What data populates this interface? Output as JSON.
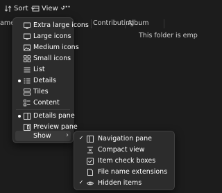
{
  "toolbar": {
    "sort_label": "Sort",
    "view_label": "View",
    "more_label": "···"
  },
  "columns": {
    "name": "ame",
    "contributing": "Contributing ...",
    "album": "Album"
  },
  "empty_message": "This folder is emp",
  "view_menu": {
    "items": [
      {
        "label": "Extra large icons",
        "icon": "monitor-icon",
        "checked": false,
        "selected": false
      },
      {
        "label": "Large icons",
        "icon": "monitor-icon",
        "checked": false,
        "selected": false
      },
      {
        "label": "Medium icons",
        "icon": "image-icon",
        "checked": false,
        "selected": false
      },
      {
        "label": "Small icons",
        "icon": "grid-icon",
        "checked": false,
        "selected": false
      },
      {
        "label": "List",
        "icon": "list-icon",
        "checked": false,
        "selected": false
      },
      {
        "label": "Details",
        "icon": "details-icon",
        "checked": false,
        "selected": true
      },
      {
        "label": "Tiles",
        "icon": "tiles-icon",
        "checked": false,
        "selected": false
      },
      {
        "label": "Content",
        "icon": "content-icon",
        "checked": false,
        "selected": false
      },
      {
        "label": "Details pane",
        "icon": "details-pane-icon",
        "checked": false,
        "selected": true
      },
      {
        "label": "Preview pane",
        "icon": "preview-pane-icon",
        "checked": false,
        "selected": false
      },
      {
        "label": "Show",
        "icon": "",
        "checked": false,
        "selected": false
      }
    ]
  },
  "show_submenu": {
    "items": [
      {
        "label": "Navigation pane",
        "icon": "navigation-pane-icon",
        "checked": true
      },
      {
        "label": "Compact view",
        "icon": "compact-view-icon",
        "checked": false
      },
      {
        "label": "Item check boxes",
        "icon": "checkbox-icon",
        "checked": false
      },
      {
        "label": "File name extensions",
        "icon": "file-icon",
        "checked": false
      },
      {
        "label": "Hidden items",
        "icon": "eye-icon",
        "checked": true
      }
    ]
  },
  "colors": {
    "background": "#1c1c1c",
    "menu_background": "#2c2c2c",
    "accent": "#60cdff"
  }
}
